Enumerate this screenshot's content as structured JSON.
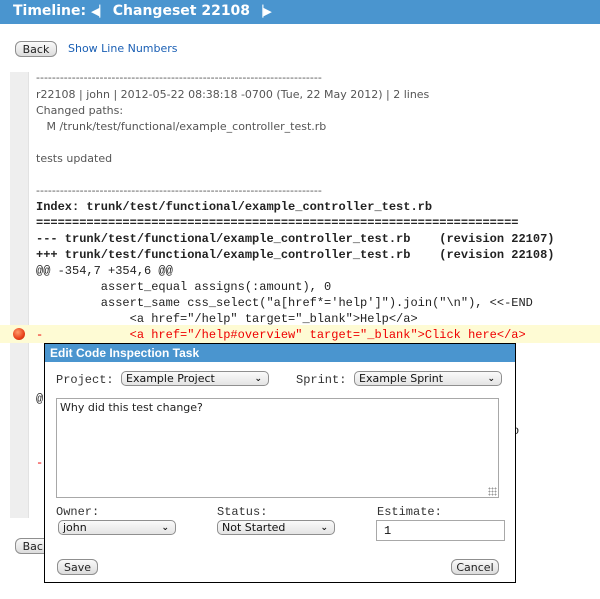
{
  "header": {
    "title_prefix": "Timeline:",
    "prev_icon": "first-arrow-icon",
    "title_main": "Changeset 22108",
    "next_icon": "last-arrow-icon"
  },
  "toolbar": {
    "back_label": "Back",
    "show_line_numbers_label": "Show Line Numbers"
  },
  "log": {
    "separator": "------------------------------------------------------------------------",
    "summary": "r22108 | john | 2012-05-22 08:38:18 -0700 (Tue, 22 May 2012) | 2 lines",
    "changed_paths_label": "Changed paths:",
    "changed_path": "   M /trunk/test/functional/example_controller_test.rb",
    "message": "tests updated",
    "separator2": "------------------------------------------------------------------------"
  },
  "diff": {
    "index": "Index: trunk/test/functional/example_controller_test.rb",
    "equals": "===================================================================",
    "old_file": "--- trunk/test/functional/example_controller_test.rb    (revision 22107)",
    "new_file": "+++ trunk/test/functional/example_controller_test.rb    (revision 22108)",
    "hunk": "@@ -354,7 +354,6 @@",
    "lines": [
      "         assert_equal assigns(:amount), 0",
      "         assert_same css_select(\"a[href*='help']\").join(\"\\n\"), <<-END",
      "             <a href=\"/help\" target=\"_blank\">Help</a>"
    ],
    "removed_line": "-            <a href=\"/help#overview\" target=\"_blank\">Click here</a>",
    "hidden_fragments": [
      "@",
      "-",
      "o"
    ]
  },
  "bottom_back_label": "Back",
  "dialog": {
    "title": "Edit Code Inspection Task",
    "project_label": "Project:",
    "project_value": "Example Project",
    "sprint_label": "Sprint:",
    "sprint_value": "Example Sprint",
    "description": "Why did this test change?",
    "owner_label": "Owner:",
    "owner_value": "john",
    "status_label": "Status:",
    "status_value": "Not Started",
    "estimate_label": "Estimate:",
    "estimate_value": "1",
    "save_label": "Save",
    "cancel_label": "Cancel"
  },
  "colors": {
    "header_bg": "#4a95cf",
    "highlight_bg": "#fefbd4",
    "removed_text": "#ee0000",
    "link": "#1a5fb4"
  }
}
